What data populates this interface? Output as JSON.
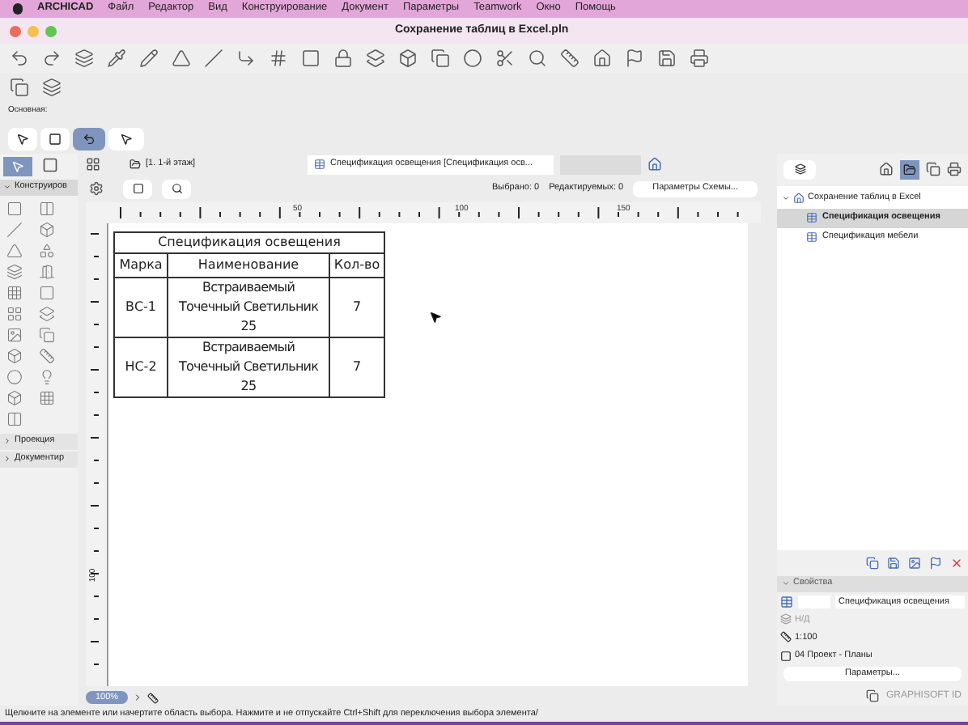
{
  "menu_bar": {
    "app": "ARCHICAD",
    "items": [
      "Файл",
      "Редактор",
      "Вид",
      "Конструирование",
      "Документ",
      "Параметры",
      "Teamwork",
      "Окно",
      "Помощь"
    ]
  },
  "window": {
    "title": "Сохранение таблиц в Excel.pln"
  },
  "toolbar_label": "Основная:",
  "toolbox": {
    "sections": [
      {
        "label": "Конструиров",
        "expanded": true
      },
      {
        "label": "Проекция",
        "expanded": false
      },
      {
        "label": "Документир",
        "expanded": false
      }
    ]
  },
  "tabs": [
    {
      "label": "[1. 1-й этаж]",
      "selected": false
    },
    {
      "label": "Спецификация освещения [Спецификация осв...",
      "selected": true
    }
  ],
  "info": {
    "selected": "Выбрано: 0",
    "editable": "Редактируемых: 0",
    "button": "Параметры Схемы..."
  },
  "ruler": {
    "h_labels": [
      "50",
      "100",
      "150"
    ],
    "v_labels": [
      "100"
    ]
  },
  "schedule": {
    "title": "Спецификация освещения",
    "columns": [
      "Марка",
      "Наименование",
      "Кол-во"
    ],
    "rows": [
      [
        "ВС-1",
        "Встраиваемый Точечный Светильник 25",
        "7"
      ],
      [
        "НС-2",
        "Встраиваемый Точечный Светильник 25",
        "7"
      ]
    ]
  },
  "zoom": "100%",
  "status": "Щелкните на элементе или начертите область выбора. Нажмите и не отпускайте Ctrl+Shift для переключения выбора элемента/",
  "navigator": {
    "items": [
      {
        "label": "Сохранение таблиц в Excel",
        "expanded": true,
        "selected": false,
        "children": [
          {
            "label": "Спецификация освещения",
            "selected": true
          },
          {
            "label": "Спецификация мебели",
            "selected": false
          }
        ]
      }
    ]
  },
  "properties": {
    "title": "Свойства",
    "expanded": true,
    "name": "Спецификация освещения",
    "layer": "Н/Д",
    "scale": "1:100",
    "layout": "04 Проект - Планы",
    "button": "Параметры..."
  },
  "footer": "GRAPHISOFT ID"
}
